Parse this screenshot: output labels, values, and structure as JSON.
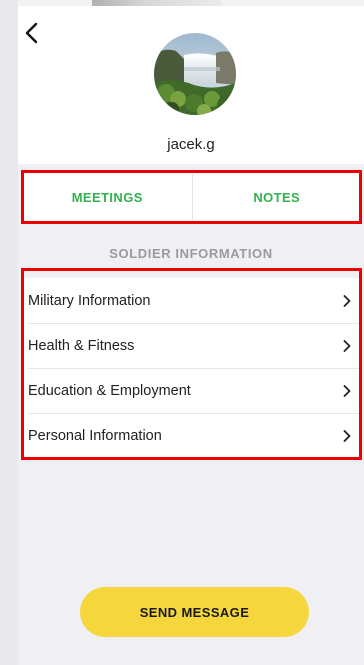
{
  "profile": {
    "username": "jacek.g"
  },
  "tabs": [
    {
      "label": "MEETINGS"
    },
    {
      "label": "NOTES"
    }
  ],
  "section": {
    "title": "SOLDIER INFORMATION"
  },
  "items": [
    {
      "label": "Military Information"
    },
    {
      "label": "Health & Fitness"
    },
    {
      "label": "Education & Employment"
    },
    {
      "label": "Personal Information"
    }
  ],
  "actions": {
    "send_message": "SEND MESSAGE"
  },
  "colors": {
    "accent_green": "#33b24f",
    "button_yellow": "#f5d63d",
    "highlight_red": "#ee0000"
  }
}
